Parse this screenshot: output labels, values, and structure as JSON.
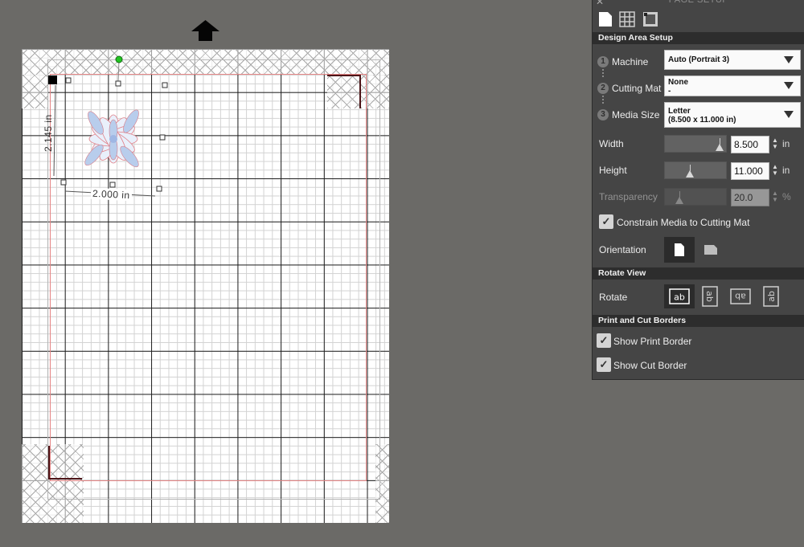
{
  "panel": {
    "title": "PAGE SETUP",
    "close_icon": "close-icon",
    "tabs": [
      {
        "icon": "page-icon",
        "active": true
      },
      {
        "icon": "grid-icon",
        "active": false
      },
      {
        "icon": "registration-marks-icon",
        "active": false
      }
    ]
  },
  "design_area": {
    "header": "Design Area Setup",
    "machine": {
      "step": "1",
      "label": "Machine",
      "value": "Auto (Portrait 3)"
    },
    "cutting_mat": {
      "step": "2",
      "label": "Cutting Mat",
      "value_line1": "None",
      "value_line2": "-"
    },
    "media_size": {
      "step": "3",
      "label": "Media Size",
      "value_line1": "Letter",
      "value_line2": "(8.500 x 11.000 in)"
    },
    "width": {
      "label": "Width",
      "value": "8.500",
      "unit": "in",
      "slider_level": 0.95
    },
    "height": {
      "label": "Height",
      "value": "11.000",
      "unit": "in",
      "slider_level": 0.4
    },
    "transparency": {
      "label": "Transparency",
      "value": "20.0",
      "unit": "%",
      "slider_level": 0.2,
      "enabled": false
    },
    "constrain": {
      "label": "Constrain Media to Cutting Mat",
      "checked": true
    },
    "orientation": {
      "label": "Orientation",
      "options": [
        "portrait",
        "landscape"
      ],
      "selected": "portrait"
    }
  },
  "rotate_view": {
    "header": "Rotate View",
    "label": "Rotate",
    "options": [
      {
        "glyph": "ab",
        "rotation_deg": 0,
        "selected": true
      },
      {
        "glyph": "ab",
        "rotation_deg": 90,
        "selected": false
      },
      {
        "glyph": "ab",
        "rotation_deg": 180,
        "selected": false
      },
      {
        "glyph": "ab",
        "rotation_deg": 270,
        "selected": false
      }
    ]
  },
  "print_cut": {
    "header": "Print and Cut Borders",
    "show_print_border": {
      "label": "Show Print Border",
      "checked": true
    },
    "show_cut_border": {
      "label": "Show Cut Border",
      "checked": true
    }
  },
  "canvas": {
    "feed_direction_icon": "up-arrow-icon",
    "selection": {
      "width_label": "2.000 in",
      "height_label": "2.145 in"
    },
    "colors": {
      "cut_border": "#e58585",
      "corner_marks": "#4d1518",
      "rotate_handle": "#22c522"
    }
  }
}
